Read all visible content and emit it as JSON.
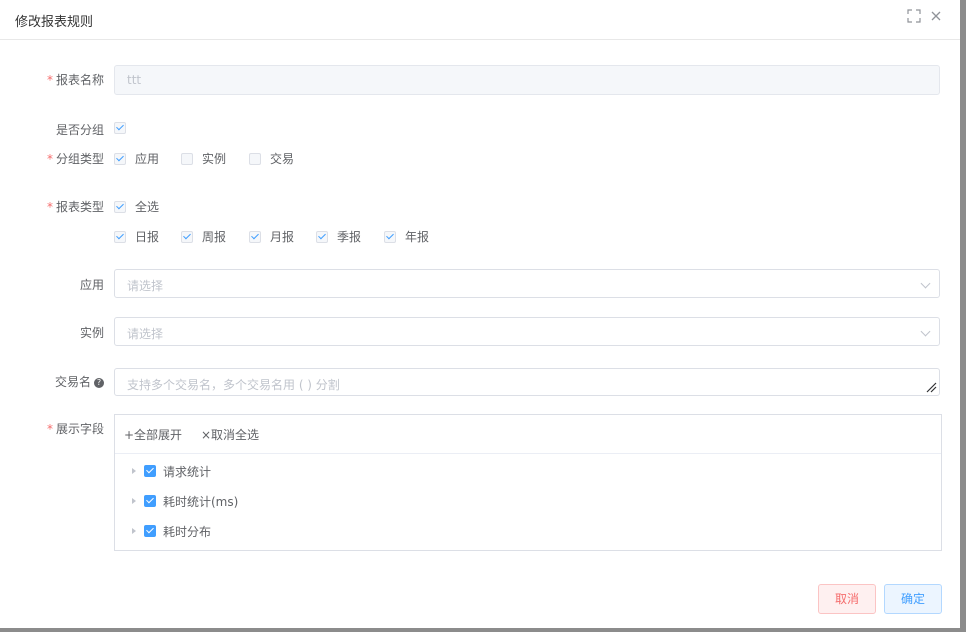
{
  "dialog": {
    "title": "修改报表规则"
  },
  "form": {
    "name_label": "报表名称",
    "name_value": "ttt",
    "is_group_label": "是否分组",
    "group_type_label": "分组类型",
    "group_options": [
      {
        "label": "应用",
        "checked": true
      },
      {
        "label": "实例",
        "checked": false
      },
      {
        "label": "交易",
        "checked": false
      }
    ],
    "report_type_label": "报表类型",
    "select_all_label": "全选",
    "report_types": [
      {
        "label": "日报",
        "checked": true
      },
      {
        "label": "周报",
        "checked": true
      },
      {
        "label": "月报",
        "checked": true
      },
      {
        "label": "季报",
        "checked": true
      },
      {
        "label": "年报",
        "checked": true
      }
    ],
    "app_label": "应用",
    "app_placeholder": "请选择",
    "instance_label": "实例",
    "instance_placeholder": "请选择",
    "trans_label": "交易名",
    "trans_placeholder": "支持多个交易名，多个交易名用 ( ) 分割",
    "display_label": "展示字段",
    "tree_tools": {
      "expand_all": "+全部展开",
      "cancel_all": "×取消全选"
    },
    "tree_items": [
      "请求统计",
      "耗时统计(ms)",
      "耗时分布"
    ]
  },
  "buttons": {
    "cancel": "取消",
    "ok": "确定"
  },
  "colors": {
    "primary": "#409eff",
    "danger": "#f56c6c"
  }
}
